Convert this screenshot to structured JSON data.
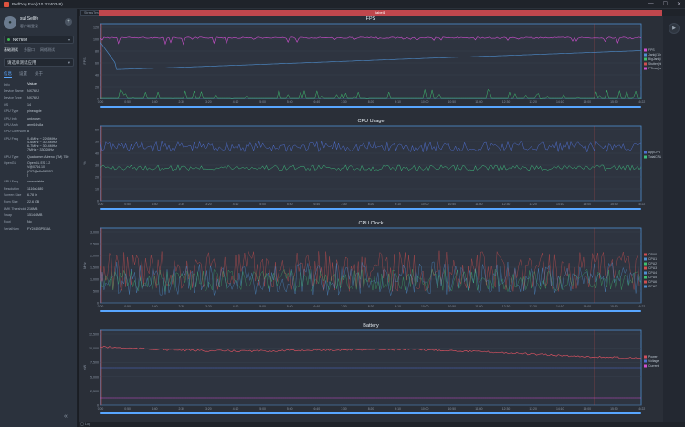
{
  "window": {
    "title": "PerfDog Evo(v10.3.240348)"
  },
  "user": {
    "name": "sul Sellfe",
    "subtitle": "客户端登录"
  },
  "device": {
    "name": "NX769J"
  },
  "mode_tabs": [
    "基础测试",
    "多窗口",
    "网络测试"
  ],
  "app": {
    "placeholder": "请选择测试应用"
  },
  "info_tabs": [
    "信息",
    "设置",
    "关于"
  ],
  "info_table": {
    "headers": [
      "Info",
      "Value"
    ],
    "rows": [
      [
        "Device Name",
        "NX769J"
      ],
      [
        "Device Type",
        "NX769J"
      ],
      [
        "OS",
        "14"
      ],
      [
        "CPU Type",
        "pineapple"
      ],
      [
        "CPU Info",
        "unknown"
      ],
      [
        "CPU Arch",
        "arm64-v8a"
      ],
      [
        "CPU CoreNum",
        "8"
      ],
      [
        "CPU Freq",
        "0-4MHz ~ 2265MHz\n4-6MHz ~ 3014MHz\n6-7MHz ~ 3014MHz\n7MHz ~ 3302MHz"
      ],
      [
        "GPU Type",
        "Qualcomm Adreno (TM) 750"
      ],
      [
        "OpenGL",
        "OpenGL ES 3.2\nV@0744.10\n(GIT@e8a5f0052\n)"
      ],
      [
        "GPU Freq",
        "unavailable"
      ],
      [
        "Resolution",
        "1116x2480"
      ],
      [
        "Screen Size",
        "6.78 in"
      ],
      [
        "Rom Size",
        "22.6 GB"
      ],
      [
        "LMK Threshold",
        "216MB"
      ],
      [
        "Swap",
        "15144 MB"
      ],
      [
        "Root",
        "No"
      ],
      [
        "SerialNum",
        "FY24193P513A"
      ]
    ]
  },
  "toolbar": {
    "top_tag": "StressTest",
    "label": "label1",
    "bottom_tag": "◯ Log"
  },
  "time_ticks": [
    "0:00",
    "0:50",
    "1:40",
    "2:30",
    "3:20",
    "4:10",
    "5:00",
    "5:50",
    "6:40",
    "7:30",
    "8:20",
    "9:10",
    "10:00",
    "10:50",
    "11:40",
    "12:30",
    "13:20",
    "14:10",
    "15:00",
    "15:50",
    "16:22"
  ],
  "charts": [
    {
      "title": "FPS",
      "ylabel": "FPS",
      "yticks": [
        "0",
        "20",
        "40",
        "60",
        "80",
        "100",
        "120"
      ],
      "legend": [
        "FPS",
        "Jank(/10min)",
        "BigJank(/10min)",
        "Stutter(%)",
        "FTime(ms)"
      ],
      "series_colors": [
        "#d04fd0",
        "#4f8fd0",
        "#3fbf6f",
        "#d04f4f"
      ]
    },
    {
      "title": "CPU Usage",
      "ylabel": "%",
      "yticks": [
        "0",
        "10",
        "20",
        "30",
        "40",
        "50",
        "60"
      ],
      "legend": [
        "AppCPU",
        "TotalCPU"
      ],
      "series_colors": [
        "#4f6fd0",
        "#3fbf7f"
      ]
    },
    {
      "title": "CPU Clock",
      "ylabel": "MHz",
      "yticks": [
        "0",
        "500",
        "1,000",
        "1,500",
        "2,000",
        "2,500",
        "3,000"
      ],
      "legend": [
        "CPU0",
        "CPU1",
        "CPU2",
        "CPU3",
        "CPU4",
        "CPU5",
        "CPU6",
        "CPU7"
      ],
      "series_colors": [
        "#d04f4f",
        "#4f8fd0",
        "#3fbf6f"
      ]
    },
    {
      "title": "Battery",
      "ylabel": "mW",
      "yticks": [
        "0",
        "2,500",
        "5,000",
        "7,500",
        "10,000",
        "12,500"
      ],
      "legend": [
        "Power",
        "Voltage",
        "Current"
      ],
      "series_colors": [
        "#d0505f",
        "#4f6fd0",
        "#d04fd0"
      ]
    }
  ],
  "colors": {
    "accent": "#c0474d",
    "panel": "#2a2f38",
    "sidebar": "#2b323d",
    "plot_border": "#4f8fd0"
  }
}
